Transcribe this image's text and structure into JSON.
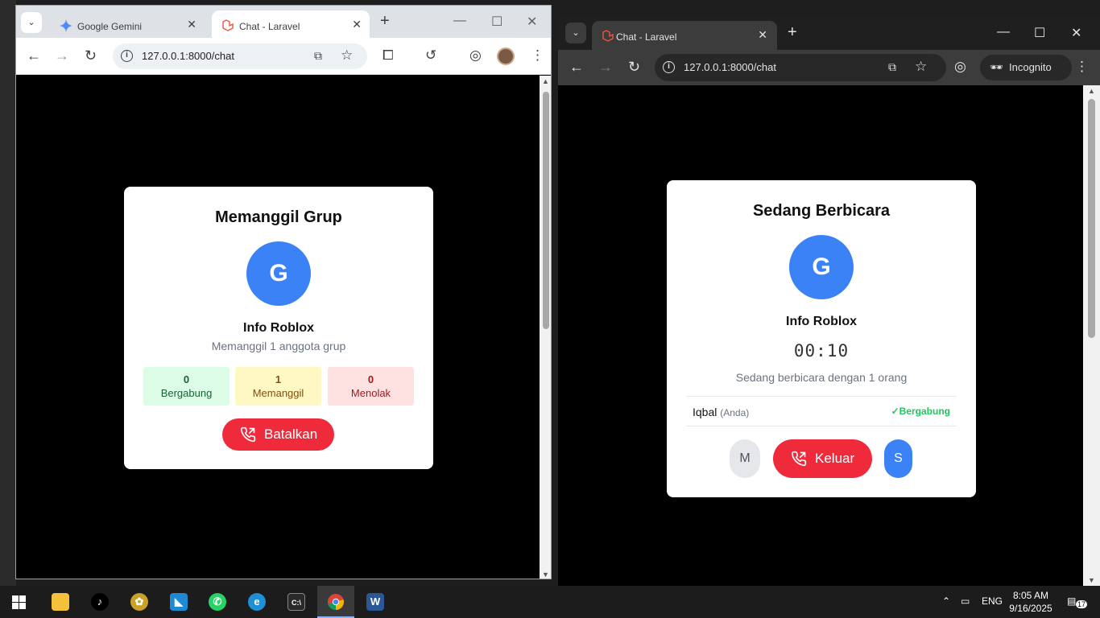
{
  "left_window": {
    "tabs": [
      {
        "title": "Google Gemini"
      },
      {
        "title": "Chat - Laravel"
      }
    ],
    "url": "127.0.0.1:8000/chat",
    "call": {
      "title": "Memanggil Grup",
      "avatar_letter": "G",
      "group_name": "Info Roblox",
      "subtitle": "Memanggil 1 anggota grup",
      "stats": [
        {
          "count": "0",
          "label": "Bergabung"
        },
        {
          "count": "1",
          "label": "Memanggil"
        },
        {
          "count": "0",
          "label": "Menolak"
        }
      ],
      "cancel_label": "Batalkan"
    }
  },
  "right_window": {
    "tab_title": "Chat - Laravel",
    "url": "127.0.0.1:8000/chat",
    "incognito_label": "Incognito",
    "call": {
      "title": "Sedang Berbicara",
      "avatar_letter": "G",
      "group_name": "Info Roblox",
      "timer": "00:10",
      "subtitle": "Sedang berbicara dengan 1 orang",
      "participant": {
        "name": "Iqbal",
        "tag": "(Anda)",
        "status": "✓Bergabung"
      },
      "mute_label": "M",
      "leave_label": "Keluar",
      "speaker_label": "S"
    }
  },
  "taskbar": {
    "language": "ENG",
    "time": "8:05 AM",
    "date": "9/16/2025",
    "notification_count": "17"
  },
  "colors": {
    "accent_blue": "#3b82f6",
    "danger_red": "#ef2a3a",
    "success_green": "#22c55e"
  }
}
